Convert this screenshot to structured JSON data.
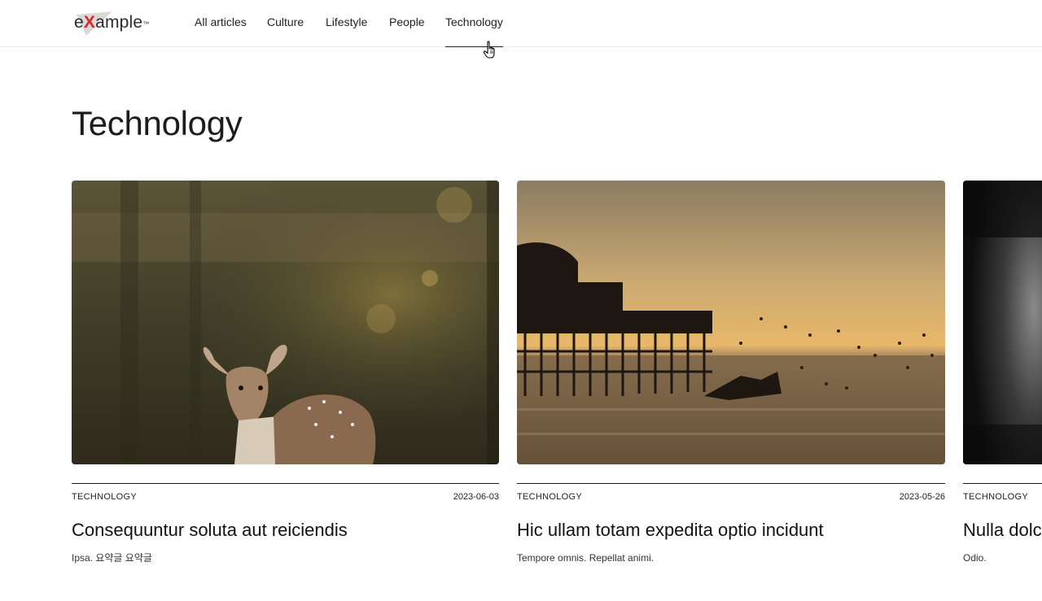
{
  "header": {
    "logo_text": "eXample",
    "logo_x": "X",
    "logo_e": "e",
    "logo_rest": "ample",
    "logo_tm": "™",
    "nav": [
      {
        "label": "All articles"
      },
      {
        "label": "Culture"
      },
      {
        "label": "Lifestyle"
      },
      {
        "label": "People"
      },
      {
        "label": "Technology",
        "active": true
      }
    ]
  },
  "page": {
    "title": "Technology"
  },
  "articles": [
    {
      "category": "TECHNOLOGY",
      "date": "2023-06-03",
      "title": "Consequuntur soluta aut reiciendis",
      "excerpt": "Ipsa. 요약글 요약글",
      "image": "deer-in-forest"
    },
    {
      "category": "TECHNOLOGY",
      "date": "2023-05-26",
      "title": "Hic ullam totam expedita optio incidunt",
      "excerpt": "Tempore omnis. Repellat animi.",
      "image": "ruined-pier-at-sunset"
    },
    {
      "category": "TECHNOLOGY",
      "date": "",
      "title": "Nulla dolc",
      "excerpt": "Odio.",
      "image": "dark-abstract"
    }
  ],
  "colors": {
    "accent": "#d42a2a",
    "text": "#1a1a1a",
    "border": "#ececec"
  }
}
